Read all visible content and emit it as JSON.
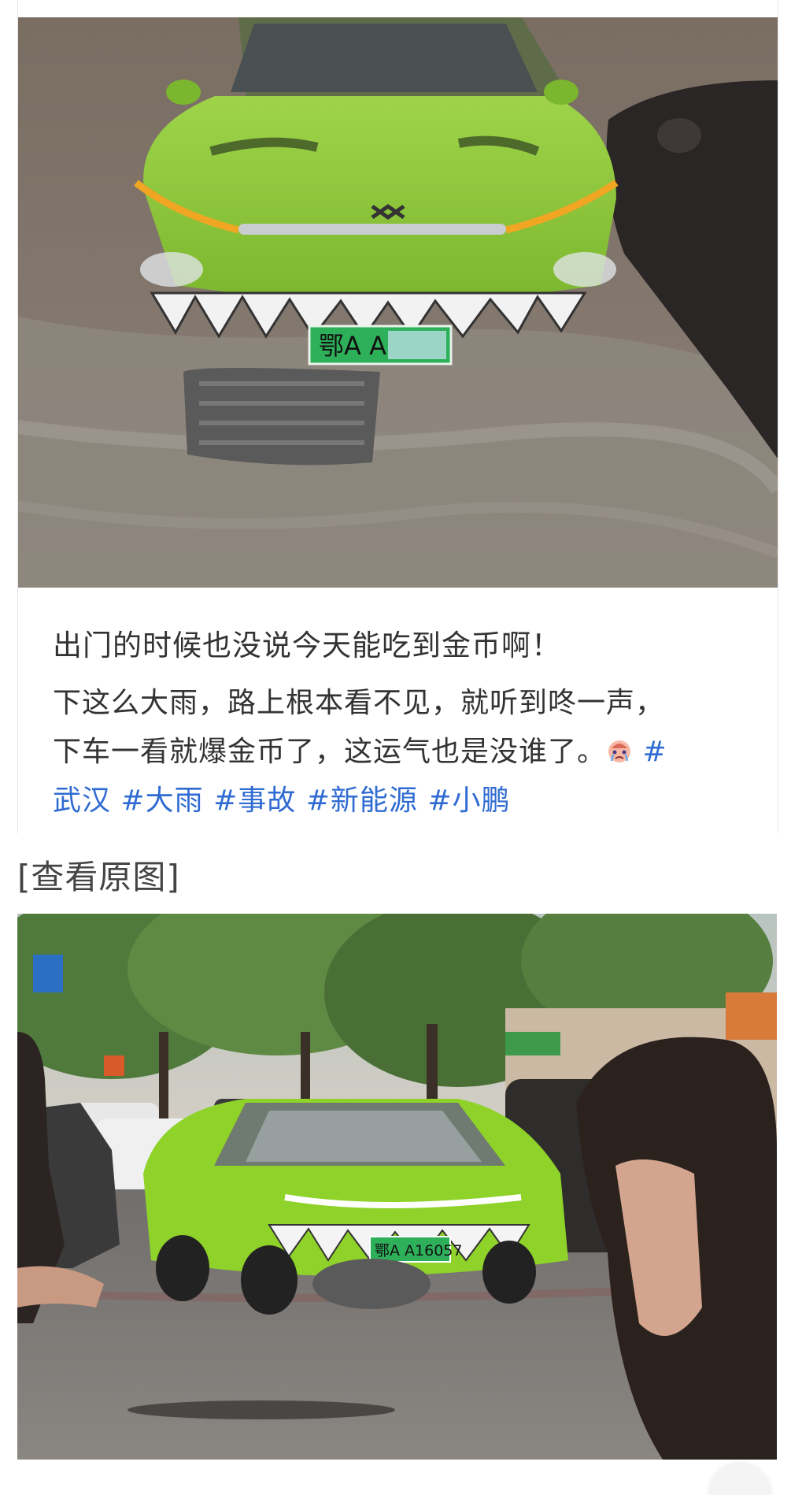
{
  "post": {
    "title": "出门的时候也没说今天能吃到金币啊！",
    "body_line1": "下这么大雨，路上根本看不见，就听到咚一声，",
    "body_line2": "下车一看就爆金币了，这运气也是没谁了。",
    "emoji_icon": "crying-face-icon",
    "hashtag_leading": "#",
    "hashtags": [
      "武汉",
      "#大雨",
      "#事故",
      "#新能源",
      "#小鹏"
    ]
  },
  "image1": {
    "plate_text": "鄂A A",
    "car_color": "#8dc63f"
  },
  "view_original_label": "[查看原图]",
  "image2": {
    "plate_text": "鄂A A16057",
    "car_color": "#8fd22a"
  },
  "colors": {
    "text": "#333333",
    "hashtag": "#2f6bd2"
  }
}
